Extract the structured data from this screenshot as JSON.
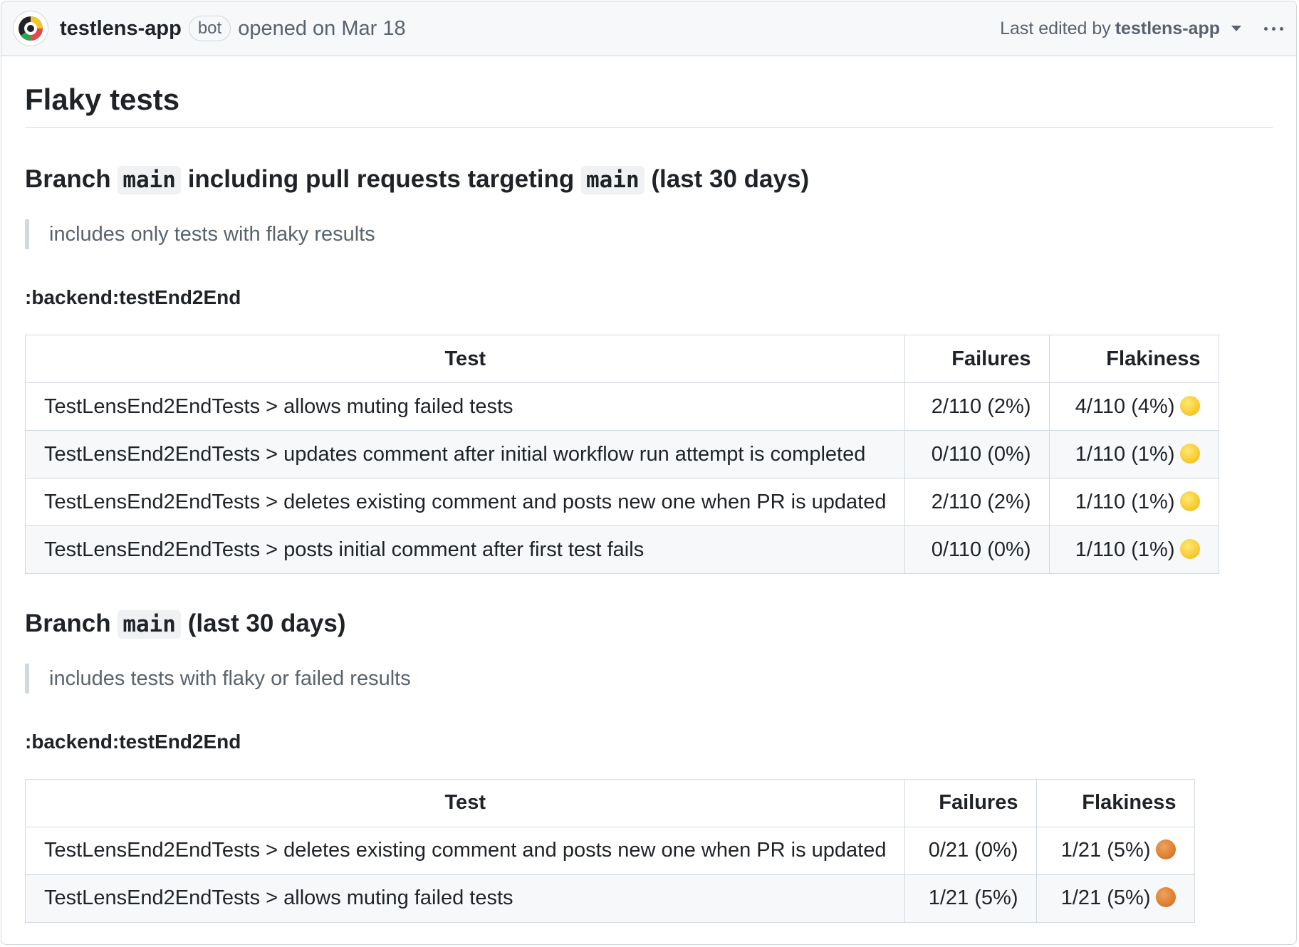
{
  "header": {
    "author": "testlens-app",
    "badge": "bot",
    "opened": "opened on Mar 18",
    "edited_prefix": "Last edited by",
    "edited_by": "testlens-app"
  },
  "title": "Flaky tests",
  "sections": [
    {
      "heading_parts": [
        "Branch ",
        "main",
        " including pull requests targeting ",
        "main",
        " (last 30 days)"
      ],
      "note": "includes only tests with flaky results",
      "task": ":backend:testEnd2End",
      "columns": [
        "Test",
        "Failures",
        "Flakiness"
      ],
      "rows": [
        {
          "test": "TestLensEnd2EndTests > allows muting failed tests",
          "failures": "2/110 (2%)",
          "flakiness": "4/110 (4%)",
          "indicator": "yellow-circle"
        },
        {
          "test": "TestLensEnd2EndTests > updates comment after initial workflow run attempt is completed",
          "failures": "0/110 (0%)",
          "flakiness": "1/110 (1%)",
          "indicator": "yellow-circle"
        },
        {
          "test": "TestLensEnd2EndTests > deletes existing comment and posts new one when PR is updated",
          "failures": "2/110 (2%)",
          "flakiness": "1/110 (1%)",
          "indicator": "yellow-circle"
        },
        {
          "test": "TestLensEnd2EndTests > posts initial comment after first test fails",
          "failures": "0/110 (0%)",
          "flakiness": "1/110 (1%)",
          "indicator": "yellow-circle"
        }
      ]
    },
    {
      "heading_parts": [
        "Branch ",
        "main",
        " (last 30 days)"
      ],
      "note": "includes tests with flaky or failed results",
      "task": ":backend:testEnd2End",
      "columns": [
        "Test",
        "Failures",
        "Flakiness"
      ],
      "rows": [
        {
          "test": "TestLensEnd2EndTests > deletes existing comment and posts new one when PR is updated",
          "failures": "0/21 (0%)",
          "flakiness": "1/21 (5%)",
          "indicator": "orange-circle"
        },
        {
          "test": "TestLensEnd2EndTests > allows muting failed tests",
          "failures": "1/21 (5%)",
          "flakiness": "1/21 (5%)",
          "indicator": "orange-circle"
        }
      ]
    }
  ],
  "colors": {
    "border": "#d0d7de",
    "header_bg": "#f6f8fa",
    "muted_text": "#59636e",
    "yellow": "#f6c626",
    "orange": "#d9782b"
  }
}
